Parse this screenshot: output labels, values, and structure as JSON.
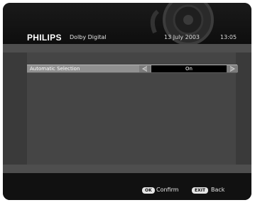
{
  "header": {
    "brand": "PHILIPS",
    "subtitle": "Dolby Digital",
    "date": "13 July 2003",
    "time": "13:05"
  },
  "setting": {
    "label": "Automatic Selection",
    "value": "On"
  },
  "footer": {
    "ok_key": "OK",
    "ok_label": "Confirm",
    "exit_key": "EXIT",
    "exit_label": "Back"
  },
  "icons": {
    "decor": "combination-lock-icon",
    "left": "arrow-left-icon",
    "right": "arrow-right-icon"
  }
}
